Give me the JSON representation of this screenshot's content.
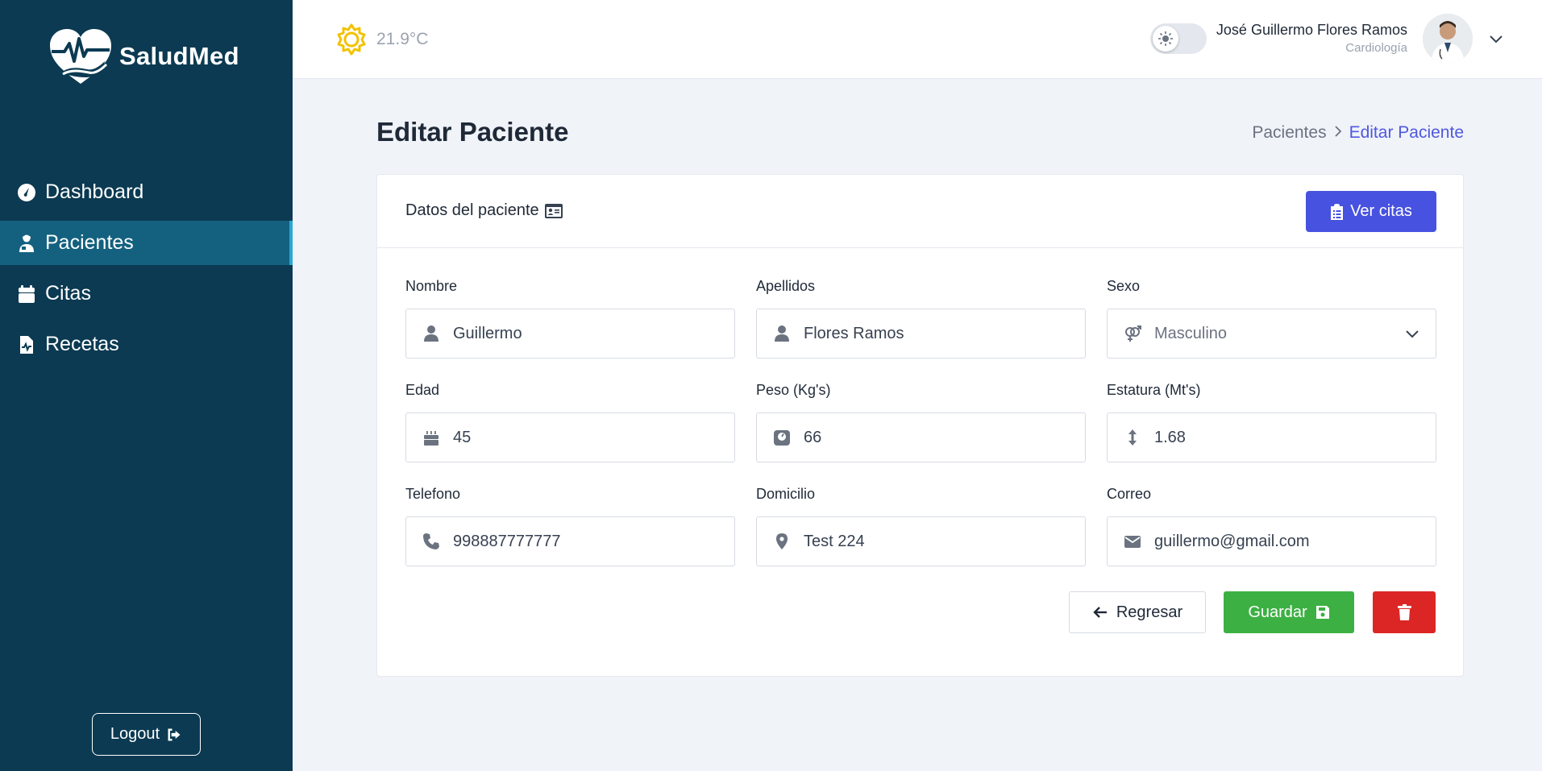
{
  "app": {
    "brand": "SaludMed",
    "colors": {
      "sidebar_bg": "#0b3a52",
      "sidebar_active": "#13617f",
      "primary": "#4752e0",
      "success": "#3cb043",
      "danger": "#dc2626",
      "page_bg": "#f0f3f8"
    }
  },
  "sidebar": {
    "items": [
      {
        "label": "Dashboard",
        "icon": "gauge-icon",
        "active": false
      },
      {
        "label": "Pacientes",
        "icon": "patient-icon",
        "active": true
      },
      {
        "label": "Citas",
        "icon": "calendar-icon",
        "active": false
      },
      {
        "label": "Recetas",
        "icon": "prescription-file-icon",
        "active": false
      }
    ],
    "logout_label": "Logout",
    "logout_icon": "sign-out-icon"
  },
  "header": {
    "weather": {
      "temperature": "21.9°C",
      "icon": "sun-icon"
    },
    "theme_toggle": {
      "mode": "light",
      "icon": "sun-small-icon"
    },
    "user": {
      "name": "José Guillermo Flores Ramos",
      "role": "Cardiología",
      "icon": "chevron-down-icon"
    }
  },
  "page": {
    "title": "Editar Paciente",
    "breadcrumb": {
      "parent": "Pacientes",
      "current": "Editar Paciente"
    }
  },
  "card": {
    "title": "Datos del paciente",
    "title_icon": "id-card-icon",
    "ver_citas_label": "Ver citas",
    "ver_citas_icon": "clipboard-list-icon"
  },
  "form": {
    "nombre": {
      "label": "Nombre",
      "value": "Guillermo",
      "icon": "user-icon"
    },
    "apellidos": {
      "label": "Apellidos",
      "value": "Flores Ramos",
      "icon": "user-icon"
    },
    "sexo": {
      "label": "Sexo",
      "value": "Masculino",
      "icon": "venus-mars-icon"
    },
    "edad": {
      "label": "Edad",
      "value": "45",
      "icon": "birthday-cake-icon"
    },
    "peso": {
      "label": "Peso (Kg's)",
      "value": "66",
      "icon": "weight-scale-icon"
    },
    "estatura": {
      "label": "Estatura (Mt's)",
      "value": "1.68",
      "icon": "arrows-vertical-icon"
    },
    "telefono": {
      "label": "Telefono",
      "value": "998887777777",
      "icon": "phone-icon"
    },
    "domicilio": {
      "label": "Domicilio",
      "value": "Test 224",
      "icon": "location-pin-icon"
    },
    "correo": {
      "label": "Correo",
      "value": "guillermo@gmail.com",
      "icon": "envelope-icon"
    }
  },
  "actions": {
    "regresar_label": "Regresar",
    "guardar_label": "Guardar",
    "delete_icon": "trash-icon"
  }
}
